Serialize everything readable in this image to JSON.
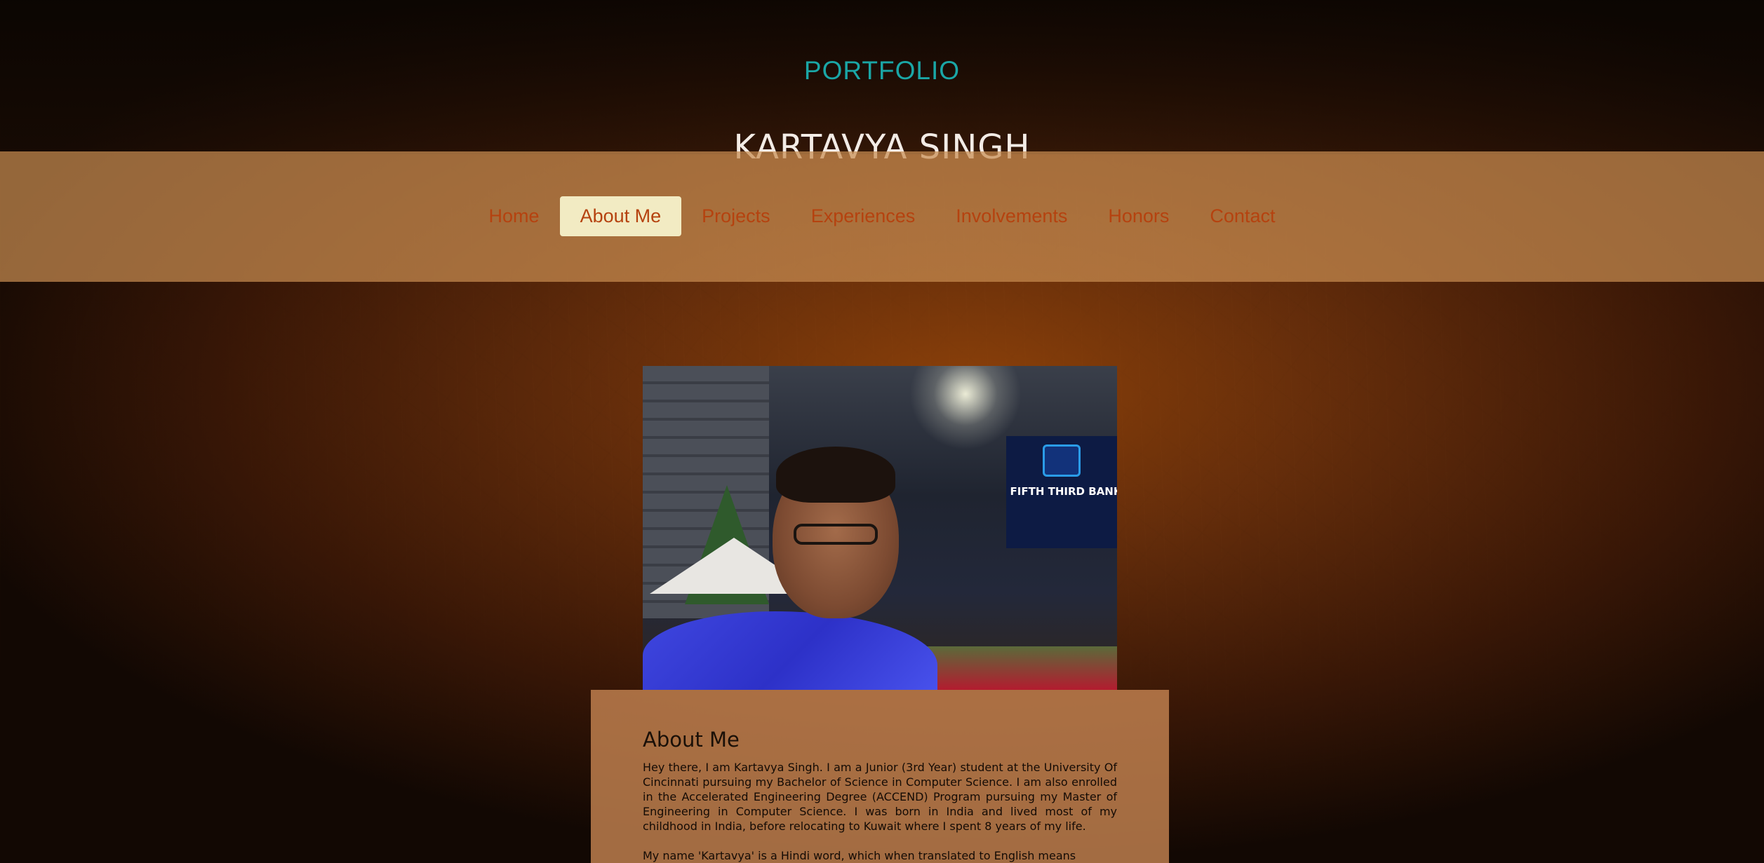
{
  "header": {
    "eyebrow": "PORTFOLIO",
    "name": "KARTAVYA SINGH"
  },
  "nav": {
    "items": [
      {
        "label": "Home",
        "active": false
      },
      {
        "label": "About Me",
        "active": true
      },
      {
        "label": "Projects",
        "active": false
      },
      {
        "label": "Experiences",
        "active": false
      },
      {
        "label": "Involvements",
        "active": false
      },
      {
        "label": "Honors",
        "active": false
      },
      {
        "label": "Contact",
        "active": false
      }
    ]
  },
  "photo": {
    "sign_text": "FIFTH THIRD BANK"
  },
  "about": {
    "title": "About Me",
    "paragraphs": [
      "Hey there, I am Kartavya Singh. I am a Junior (3rd Year) student at the University Of Cincinnati pursuing my Bachelor of Science in Computer Science. I am also enrolled in the Accelerated Engineering Degree (ACCEND) Program pursuing my Master of Engineering in Computer Science. I was born in India and lived most of my childhood in India, before relocating to Kuwait where I spent 8 years of my life.",
      "My name 'Kartavya' is a Hindi word, which when translated to English means"
    ]
  },
  "colors": {
    "accent_teal": "#1aa6a6",
    "nav_text": "#b5420f",
    "nav_active_bg": "#f2ebc3",
    "navbar_bg": "#c88c50"
  }
}
